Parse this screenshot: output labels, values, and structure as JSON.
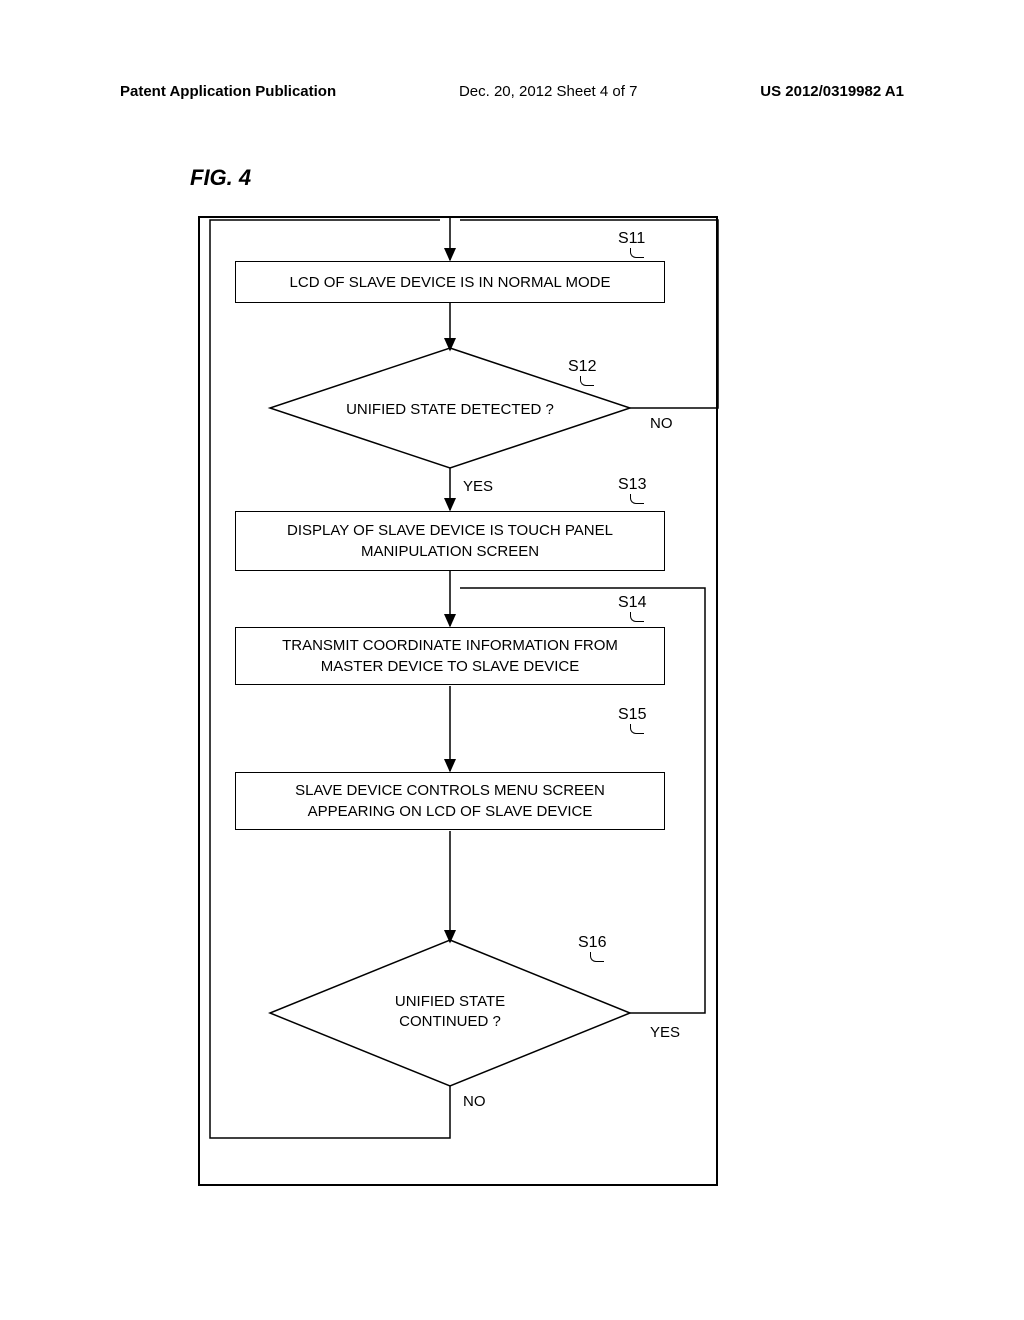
{
  "header": {
    "left": "Patent Application Publication",
    "center": "Dec. 20, 2012  Sheet 4 of 7",
    "right": "US 2012/0319982 A1"
  },
  "figure_label": "FIG. 4",
  "steps": {
    "s11": {
      "label": "S11",
      "text": "LCD OF SLAVE DEVICE IS IN NORMAL MODE"
    },
    "s12": {
      "label": "S12",
      "text": "UNIFIED STATE DETECTED ?",
      "yes": "YES",
      "no": "NO"
    },
    "s13": {
      "label": "S13",
      "text1": "DISPLAY OF SLAVE DEVICE IS TOUCH PANEL",
      "text2": "MANIPULATION SCREEN"
    },
    "s14": {
      "label": "S14",
      "text1": "TRANSMIT COORDINATE INFORMATION FROM",
      "text2": "MASTER DEVICE TO SLAVE DEVICE"
    },
    "s15": {
      "label": "S15",
      "text1": "SLAVE DEVICE CONTROLS MENU SCREEN",
      "text2": "APPEARING ON LCD OF SLAVE DEVICE"
    },
    "s16": {
      "label": "S16",
      "text1": "UNIFIED STATE",
      "text2": "CONTINUED ?",
      "yes": "YES",
      "no": "NO"
    }
  }
}
